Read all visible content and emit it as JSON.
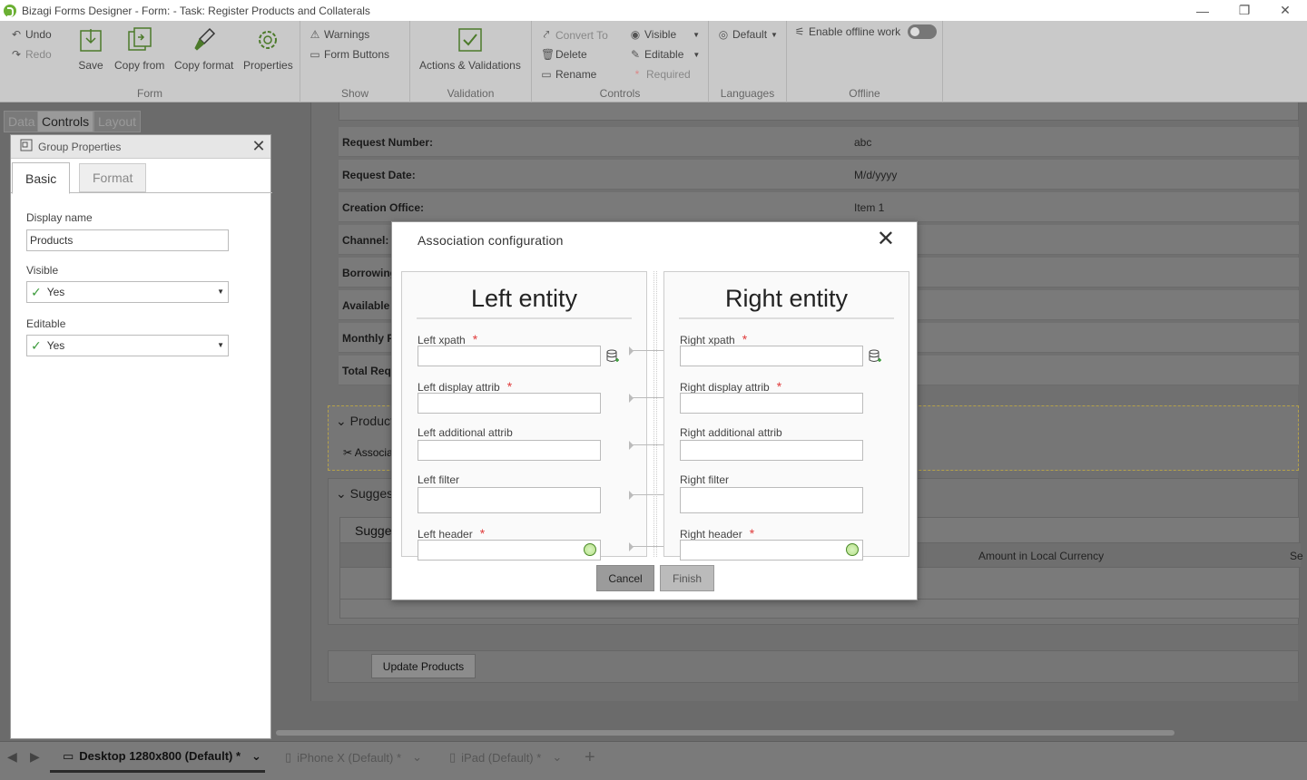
{
  "window": {
    "title": "Bizagi Forms Designer  - Form:  - Task:  Register Products and Collaterals",
    "minimize": "—",
    "restore": "❐",
    "close": "✕"
  },
  "ribbon": {
    "form_group": {
      "label": "Form",
      "undo": "Undo",
      "redo": "Redo",
      "save": "Save",
      "copy_from": "Copy from",
      "copy_format": "Copy format",
      "properties": "Properties"
    },
    "show_group": {
      "label": "Show",
      "warnings": "Warnings",
      "form_buttons": "Form Buttons"
    },
    "validation_group": {
      "label": "Validation",
      "actions": "Actions & Validations"
    },
    "controls_group": {
      "label": "Controls",
      "convert_to": "Convert To",
      "delete": "Delete",
      "rename": "Rename",
      "visible": "Visible",
      "editable": "Editable",
      "required": "Required"
    },
    "languages_group": {
      "label": "Languages",
      "default": "Default"
    },
    "offline_group": {
      "label": "Offline",
      "enable_offline": "Enable offline work"
    }
  },
  "left_tabs": [
    "Data",
    "Controls",
    "Layout"
  ],
  "group_properties": {
    "title": "Group Properties",
    "tabs": [
      "Basic",
      "Format"
    ],
    "display_name_label": "Display name",
    "display_name_value": "Products",
    "visible_label": "Visible",
    "visible_value": "Yes",
    "editable_label": "Editable",
    "editable_value": "Yes"
  },
  "form": {
    "rows": [
      {
        "label": "Request Number:",
        "value": "abc"
      },
      {
        "label": "Request Date:",
        "value": "M/d/yyyy"
      },
      {
        "label": "Creation Office:",
        "value": "Item 1"
      },
      {
        "label": "Channel:",
        "value": ""
      },
      {
        "label": "Borrowing",
        "value": ""
      },
      {
        "label": "Available",
        "value": ""
      },
      {
        "label": "Monthly F",
        "value": ""
      },
      {
        "label": "Total Requ",
        "value": ""
      }
    ],
    "products_group": "Product",
    "association_label": "Associa",
    "suggested_group": "Suggest",
    "suggested_inner": "Sugge",
    "amount_col": "Amount in Local Currency",
    "se_col": "Se",
    "update_button": "Update Products"
  },
  "bottom_tabs": [
    {
      "label": "Desktop 1280x800 (Default) *"
    },
    {
      "label": "iPhone X (Default) *"
    },
    {
      "label": "iPad (Default) *"
    }
  ],
  "modal": {
    "title": "Association configuration",
    "left": {
      "heading": "Left entity",
      "xpath": "Left xpath",
      "display_attrib": "Left display attrib",
      "additional_attrib": "Left additional attrib",
      "filter": "Left filter",
      "header": "Left header"
    },
    "right": {
      "heading": "Right entity",
      "xpath": "Right xpath",
      "display_attrib": "Right display attrib",
      "additional_attrib": "Right additional attrib",
      "filter": "Right filter",
      "header": "Right header"
    },
    "required_mark": "*",
    "cancel": "Cancel",
    "finish": "Finish"
  }
}
